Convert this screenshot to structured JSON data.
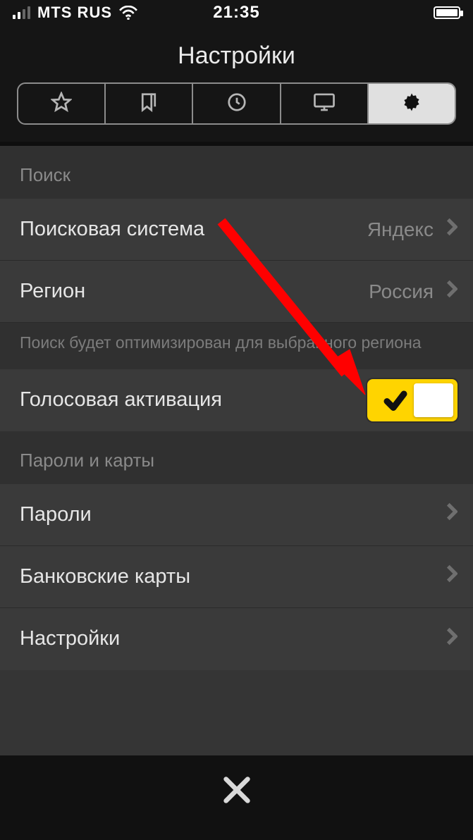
{
  "status": {
    "carrier": "MTS RUS",
    "time": "21:35"
  },
  "header": {
    "title": "Настройки"
  },
  "tabs": [
    {
      "name": "favorites-tab",
      "icon": "star-icon"
    },
    {
      "name": "bookmarks-tab",
      "icon": "bookmark-icon"
    },
    {
      "name": "history-tab",
      "icon": "clock-icon"
    },
    {
      "name": "devices-tab",
      "icon": "monitor-icon"
    },
    {
      "name": "settings-tab",
      "icon": "gear-icon",
      "active": true
    }
  ],
  "sections": {
    "search": {
      "header": "Поиск",
      "engine": {
        "label": "Поисковая система",
        "value": "Яндекс"
      },
      "region": {
        "label": "Регион",
        "value": "Россия"
      },
      "footer": "Поиск будет оптимизирован для выбранного региона",
      "voice": {
        "label": "Голосовая активация",
        "on": true
      }
    },
    "passwords": {
      "header": "Пароли и карты",
      "rows": {
        "passwords": {
          "label": "Пароли"
        },
        "cards": {
          "label": "Банковские карты"
        },
        "settings": {
          "label": "Настройки"
        }
      }
    }
  }
}
